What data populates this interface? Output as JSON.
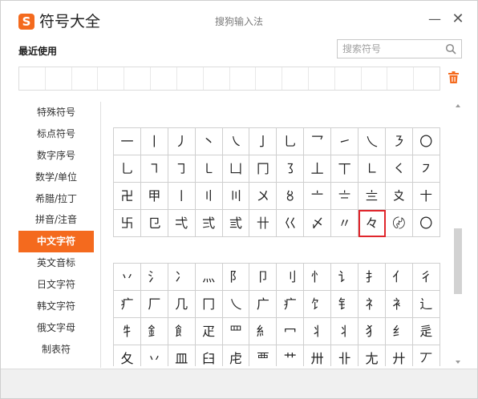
{
  "header": {
    "logo_glyph": "S",
    "app_title": "符号大全",
    "window_caption": "搜狗输入法",
    "minimize_glyph": "—",
    "close_glyph": "✕"
  },
  "recent": {
    "label": "最近使用",
    "cell_count": 16
  },
  "search": {
    "placeholder": "搜索符号",
    "value": ""
  },
  "sidebar": {
    "items": [
      {
        "label": "特殊符号",
        "active": false
      },
      {
        "label": "标点符号",
        "active": false
      },
      {
        "label": "数字序号",
        "active": false
      },
      {
        "label": "数学/单位",
        "active": false
      },
      {
        "label": "希腊/拉丁",
        "active": false
      },
      {
        "label": "拼音/注音",
        "active": false
      },
      {
        "label": "中文字符",
        "active": true
      },
      {
        "label": "英文音标",
        "active": false
      },
      {
        "label": "日文字符",
        "active": false
      },
      {
        "label": "韩文字符",
        "active": false
      },
      {
        "label": "俄文字母",
        "active": false
      },
      {
        "label": "制表符",
        "active": false
      }
    ]
  },
  "grid1": {
    "chars": [
      "一",
      "丨",
      "丿",
      "丶",
      "㇏",
      "亅",
      "乚",
      "乛",
      "㇀",
      "乀",
      "㇋",
      "〇",
      "乚",
      "㇕",
      "㇆",
      "㇄",
      "凵",
      "冂",
      "㇌",
      "丄",
      "丅",
      "㇗",
      "㇛",
      "㇇",
      "卍",
      "甲",
      "〡",
      "〢",
      "〣",
      "〤",
      "〥",
      "〦",
      "〧",
      "〨",
      "〩",
      "〸",
      "卐",
      "㔾",
      "弌",
      "弍",
      "弎",
      "卄",
      "巜",
      "〆",
      "〃",
      "々",
      "〄",
      "〇"
    ],
    "selected_index": 45
  },
  "grid2": {
    "chars": [
      "丷",
      "氵",
      "冫",
      "灬",
      "阝",
      "卩",
      "刂",
      "忄",
      "讠",
      "扌",
      "亻",
      "彳",
      "疒",
      "厂",
      "几",
      "冂",
      "乀",
      "广",
      "疒",
      "饣",
      "钅",
      "礻",
      "衤",
      "辶",
      "牜",
      "釒",
      "飠",
      "疋",
      "罒",
      "糹",
      "冖",
      "丬",
      "丬",
      "犭",
      "纟",
      "辵",
      "夂",
      "丷",
      "皿",
      "臼",
      "虍",
      "覀",
      "艹",
      "卅",
      "卝",
      "尢",
      "廾",
      "丆"
    ]
  },
  "scrollbar": {
    "position": 0.48
  }
}
